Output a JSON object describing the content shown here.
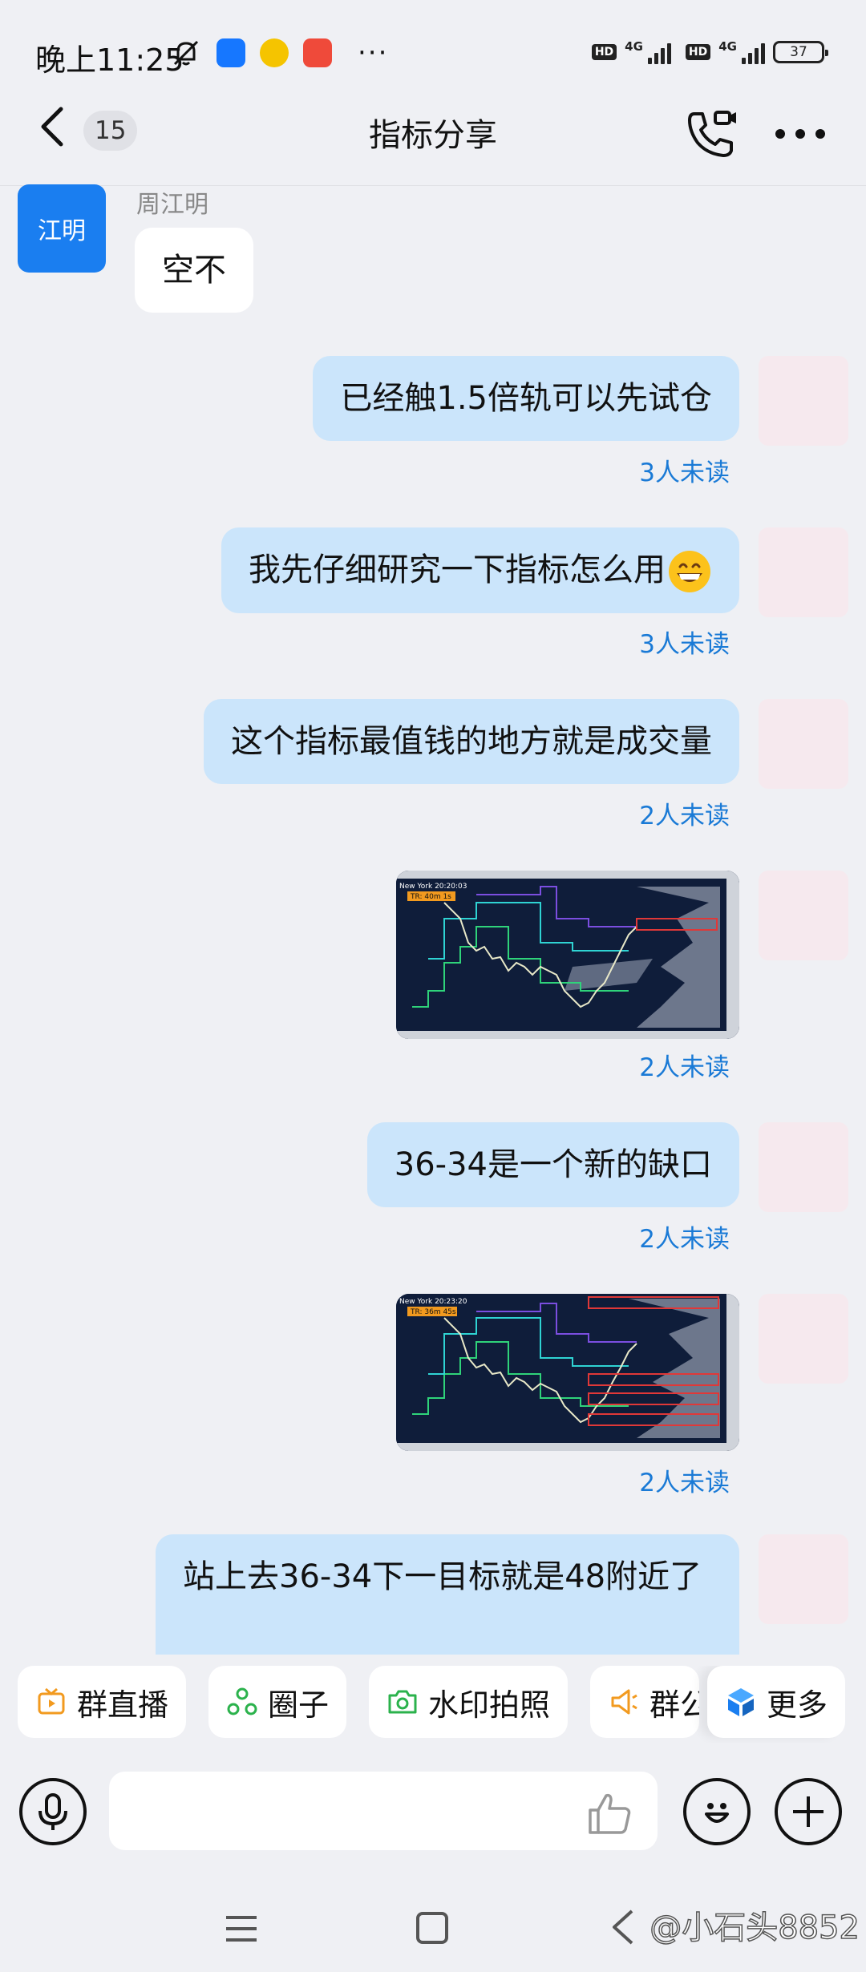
{
  "status_bar": {
    "time": "晚上11:25",
    "more": "···",
    "hd1": "HD",
    "net1": "4G",
    "hd2": "HD",
    "net2": "4G",
    "battery": "37"
  },
  "header": {
    "unread_count": "15",
    "title": "指标分享"
  },
  "messages": [
    {
      "direction": "in",
      "sender": "周江明",
      "avatar_text": "江明",
      "text": "空不"
    },
    {
      "direction": "out",
      "text": "已经触1.5倍轨可以先试仓",
      "status": "3人未读"
    },
    {
      "direction": "out",
      "text": "我先仔细研究一下指标怎么用",
      "status": "3人未读"
    },
    {
      "direction": "out",
      "text": "这个指标最值钱的地方就是成交量",
      "status": "2人未读"
    },
    {
      "direction": "out",
      "type": "image",
      "chart_header": "New York 20:20:03",
      "chart_tag": "TR: 40m 1s",
      "status": "2人未读"
    },
    {
      "direction": "out",
      "text": "36-34是一个新的缺口",
      "status": "2人未读"
    },
    {
      "direction": "out",
      "type": "image",
      "chart_header": "New York 20:23:20",
      "chart_tag": "TR: 36m 45s",
      "status": "2人未读"
    },
    {
      "direction": "out",
      "text": "站上去36-34下一目标就是48附近了"
    }
  ],
  "quick_actions": [
    {
      "label": "群直播",
      "icon": "live-tv-icon",
      "color": "#f29a1f"
    },
    {
      "label": "圈子",
      "icon": "circle-group-icon",
      "color": "#2bb24c"
    },
    {
      "label": "水印拍照",
      "icon": "camera-icon",
      "color": "#2bb24c"
    },
    {
      "label": "群公告",
      "icon": "announcement-icon",
      "color": "#f29a1f"
    },
    {
      "label": "更多",
      "icon": "more-cube-icon",
      "color": "#1a7ef0"
    }
  ],
  "watermark": "@小石头8852"
}
